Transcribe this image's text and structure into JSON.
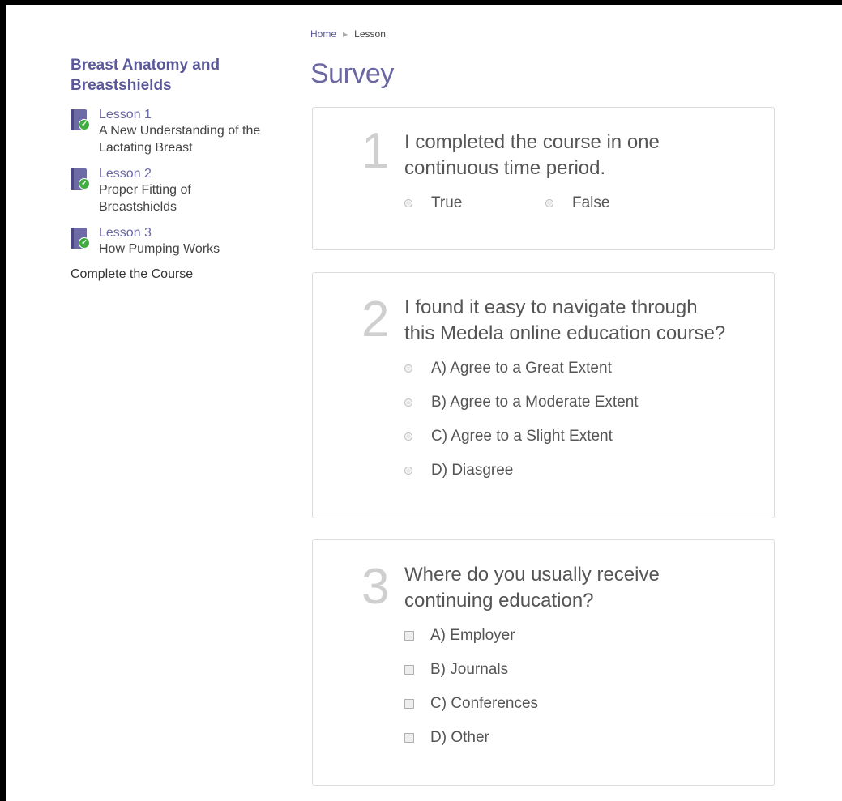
{
  "breadcrumb": {
    "home": "Home",
    "current": "Lesson"
  },
  "page_title": "Survey",
  "sidebar": {
    "course_title_line1": "Breast Anatomy and",
    "course_title_line2": "Breastshields",
    "lessons": [
      {
        "num": "Lesson 1",
        "name_line1": "A New Understanding of the",
        "name_line2": "Lactating Breast"
      },
      {
        "num": "Lesson 2",
        "name_line1": "Proper Fitting of",
        "name_line2": "Breastshields"
      },
      {
        "num": "Lesson 3",
        "name_line1": "How Pumping Works",
        "name_line2": ""
      }
    ],
    "complete": "Complete the Course"
  },
  "questions": [
    {
      "num": "1",
      "text_line1": "I completed the course in one",
      "text_line2": "continuous time period.",
      "options": [
        "True",
        "False"
      ]
    },
    {
      "num": "2",
      "text_line1": "I found it easy to navigate through",
      "text_line2": "this Medela online education course?",
      "options": [
        "A) Agree to a Great Extent",
        "B) Agree to a Moderate Extent",
        "C) Agree to a Slight Extent",
        "D) Diasgree"
      ]
    },
    {
      "num": "3",
      "text_line1": "Where do you usually receive",
      "text_line2": "continuing education?",
      "options": [
        "A) Employer",
        "B) Journals",
        "C) Conferences",
        "D) Other"
      ]
    }
  ]
}
